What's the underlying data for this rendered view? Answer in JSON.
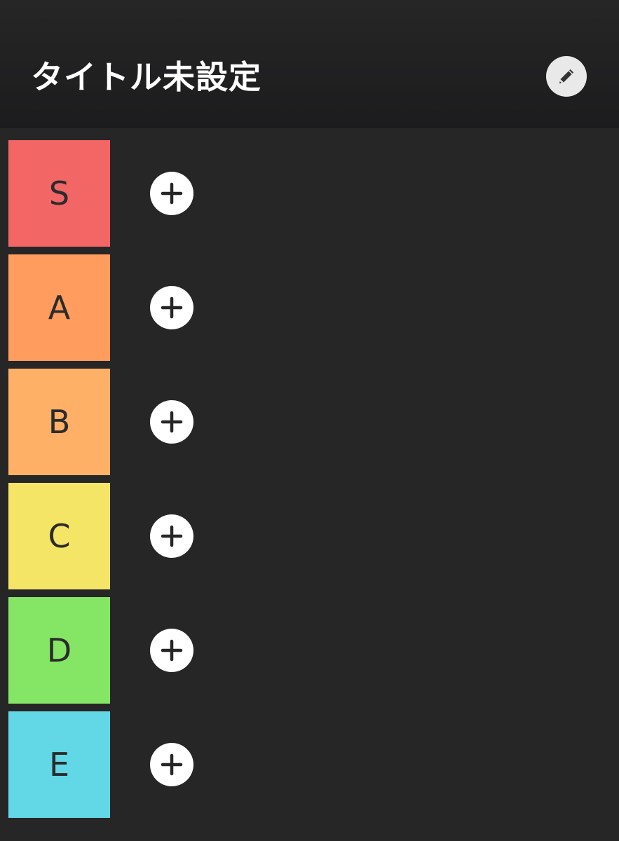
{
  "header": {
    "title": "タイトル未設定",
    "edit_icon": "pencil-icon"
  },
  "tiers": [
    {
      "label": "S",
      "color": "#f26666",
      "add_icon": "plus-icon"
    },
    {
      "label": "A",
      "color": "#ff9c5e",
      "add_icon": "plus-icon"
    },
    {
      "label": "B",
      "color": "#ffb067",
      "add_icon": "plus-icon"
    },
    {
      "label": "C",
      "color": "#f4e566",
      "add_icon": "plus-icon"
    },
    {
      "label": "D",
      "color": "#84e664",
      "add_icon": "plus-icon"
    },
    {
      "label": "E",
      "color": "#62d8e6",
      "add_icon": "plus-icon"
    }
  ]
}
